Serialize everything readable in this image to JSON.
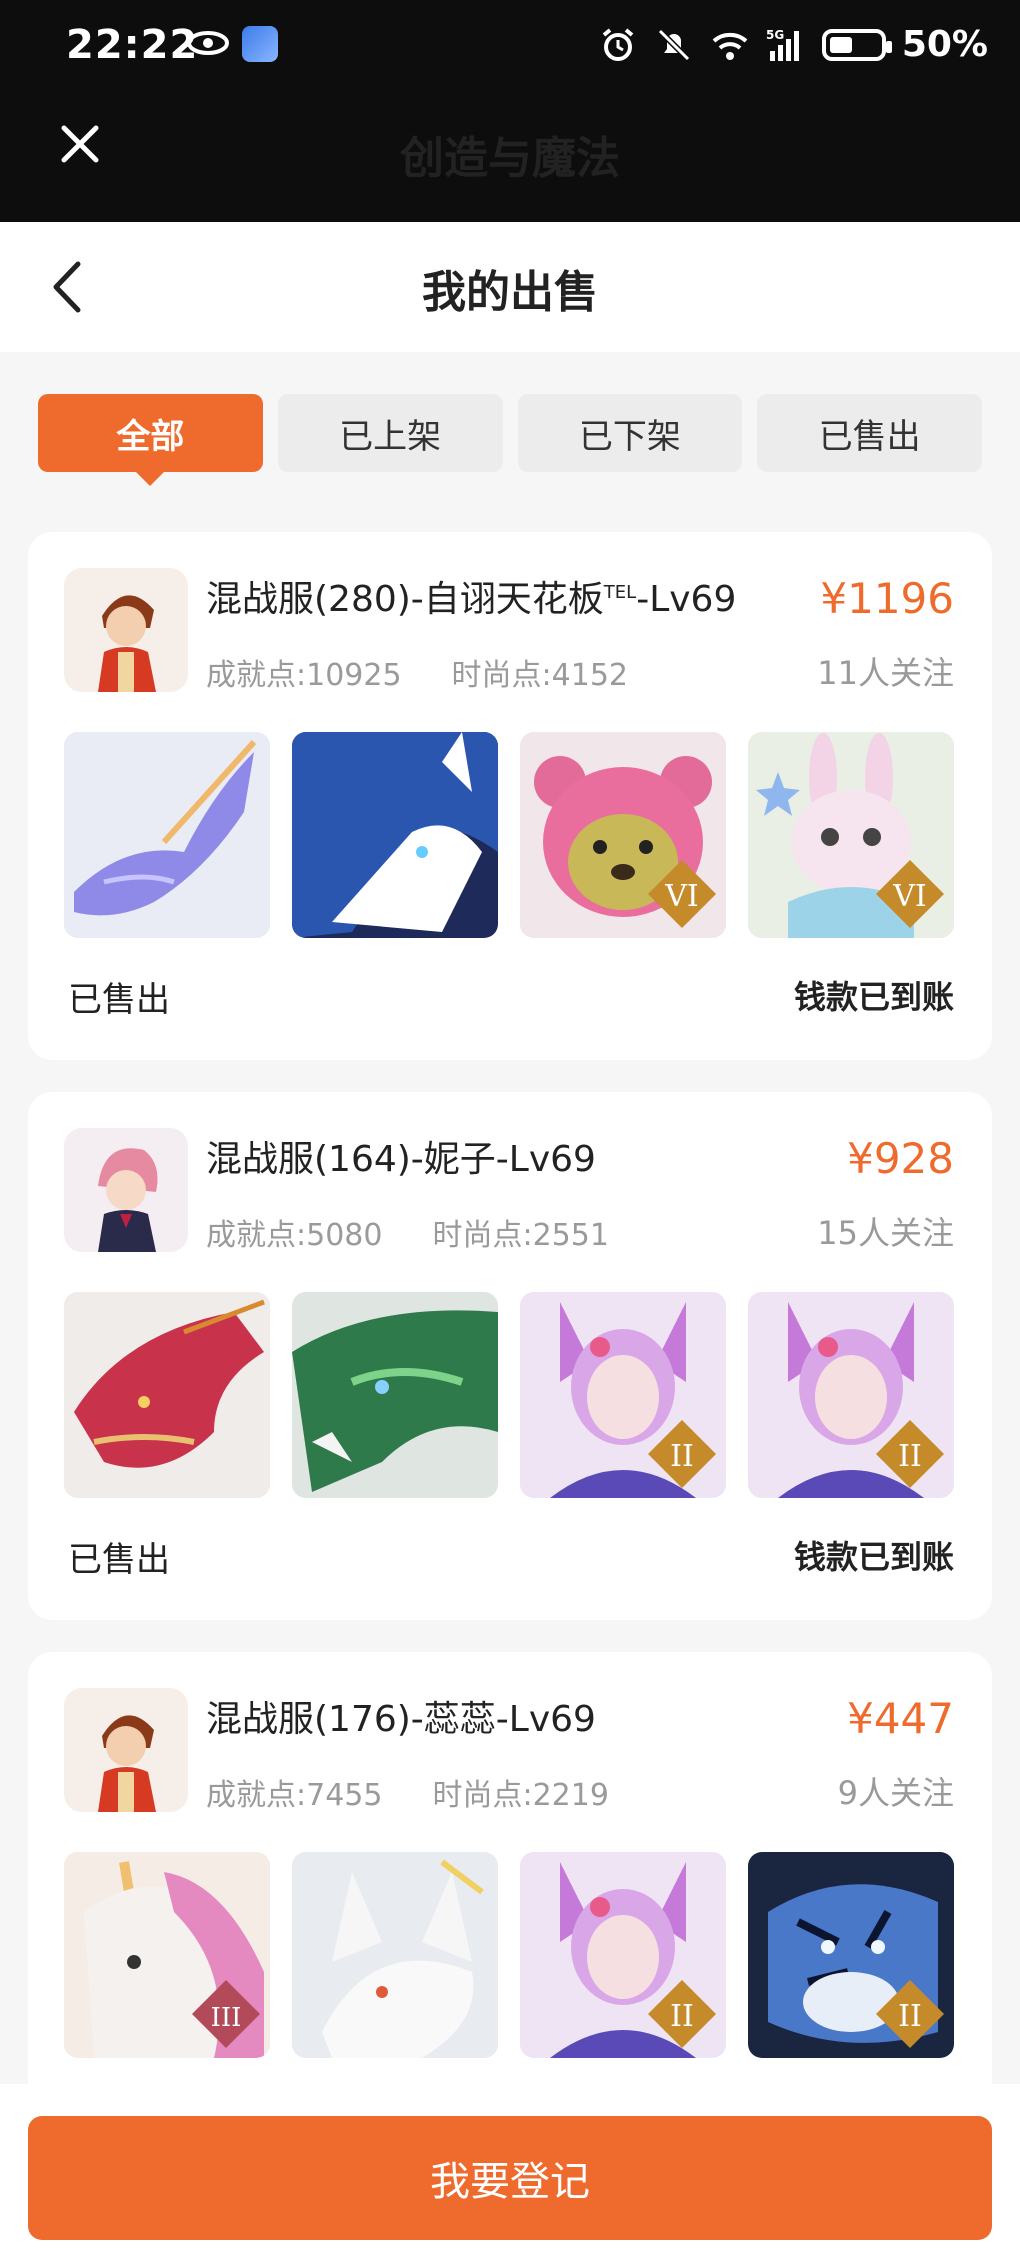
{
  "status_bar": {
    "time": "22:22",
    "battery": "50%",
    "signal": "5G",
    "wifi_label": "6"
  },
  "app_bar": {
    "title": "创造与魔法"
  },
  "nav": {
    "title": "我的出售"
  },
  "tabs": [
    {
      "label": "全部",
      "active": true
    },
    {
      "label": "已上架",
      "active": false
    },
    {
      "label": "已下架",
      "active": false
    },
    {
      "label": "已售出",
      "active": false
    }
  ],
  "listings": [
    {
      "name": "混战服(280)-自诩天花板",
      "name_sup": "TEL",
      "name_suffix": "-Lv69",
      "price": "¥1196",
      "achievement": "成就点:10925",
      "fashion": "时尚点:4152",
      "follows": "11人关注",
      "status": "已售出",
      "payment": "钱款已到账",
      "thumbs": [
        {
          "icon": "purple-dragon",
          "badge": ""
        },
        {
          "icon": "blue-wolf",
          "badge": ""
        },
        {
          "icon": "pink-bear",
          "badge": "VI"
        },
        {
          "icon": "pink-rabbit",
          "badge": "VI"
        }
      ]
    },
    {
      "name": "混战服(164)-妮子-Lv69",
      "name_sup": "",
      "name_suffix": "",
      "price": "¥928",
      "achievement": "成就点:5080",
      "fashion": "时尚点:2551",
      "follows": "15人关注",
      "status": "已售出",
      "payment": "钱款已到账",
      "thumbs": [
        {
          "icon": "red-dragon",
          "badge": ""
        },
        {
          "icon": "green-dragon",
          "badge": ""
        },
        {
          "icon": "fox-girl",
          "badge": "II"
        },
        {
          "icon": "fox-girl",
          "badge": "II"
        }
      ]
    },
    {
      "name": "混战服(176)-蕊蕊-Lv69",
      "name_sup": "",
      "name_suffix": "",
      "price": "¥447",
      "achievement": "成就点:7455",
      "fashion": "时尚点:2219",
      "follows": "9人关注",
      "status": "",
      "payment": "",
      "thumbs": [
        {
          "icon": "unicorn",
          "badge": "III"
        },
        {
          "icon": "white-fox",
          "badge": ""
        },
        {
          "icon": "fox-girl",
          "badge": "II"
        },
        {
          "icon": "blue-tiger",
          "badge": "II"
        }
      ]
    }
  ],
  "footer": {
    "button_label": "我要登记"
  },
  "colors": {
    "accent": "#ee6b2d",
    "text_primary": "#222222",
    "text_secondary": "#9a9a9a"
  }
}
